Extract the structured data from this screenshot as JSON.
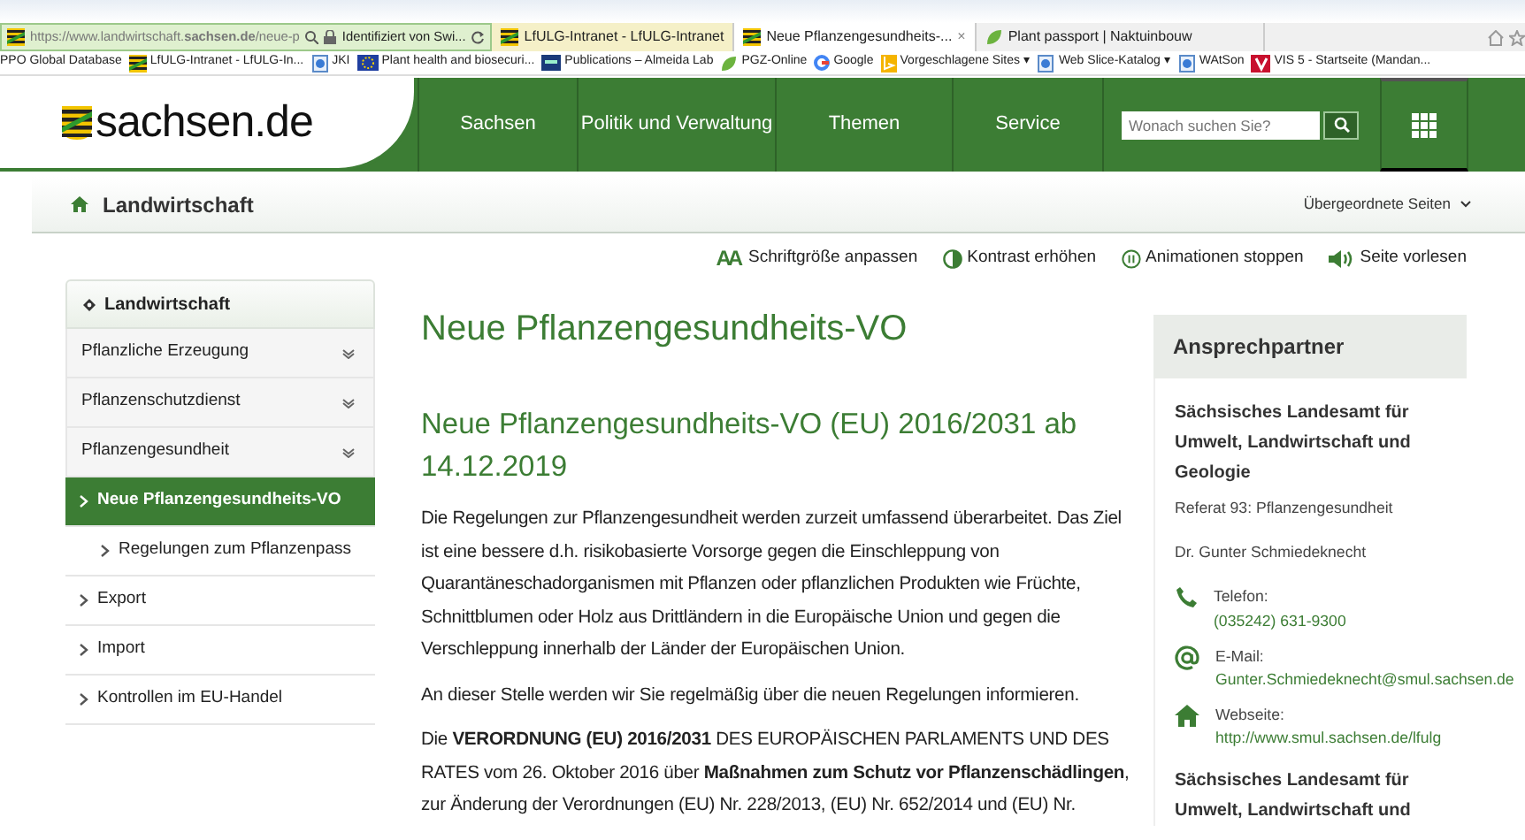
{
  "browser": {
    "address": {
      "url": "https://www.landwirtschaft.**sachsen.de**/neue-p",
      "security": "Identifiziert von Swi..."
    },
    "tabs": [
      {
        "label": "LfULG-Intranet - LfULG-Intranet",
        "selected": false,
        "kind": "crest"
      },
      {
        "label": "Neue Pflanzengesundheits-...",
        "selected": true,
        "kind": "crest",
        "close": "×"
      },
      {
        "label": "Plant passport | Naktuinbouw",
        "selected": false,
        "kind": "leaf"
      }
    ],
    "favorites": [
      {
        "label": "PPO Global Database"
      },
      {
        "label": "LfULG-Intranet - LfULG-In...",
        "kind": "crest"
      },
      {
        "label": "JKI",
        "kind": "page"
      },
      {
        "label": "Plant health and biosecuri...",
        "kind": "flag"
      },
      {
        "label": "Publications – Almeida Lab",
        "kind": "square"
      },
      {
        "label": "PGZ-Online",
        "kind": "leaf"
      },
      {
        "label": "Google",
        "kind": "google"
      },
      {
        "label": "Vorgeschlagene Sites ▾",
        "kind": "bing"
      },
      {
        "label": "Web Slice-Katalog ▾",
        "kind": "page"
      },
      {
        "label": "WAtSon",
        "kind": "page"
      },
      {
        "label": "VIS 5 - Startseite (Mandan...",
        "kind": "vis"
      }
    ]
  },
  "site": {
    "logo": "sachsen.de",
    "nav": [
      "Sachsen",
      "Politik und Verwaltung",
      "Themen",
      "Service"
    ],
    "search": {
      "placeholder": "Wonach suchen Sie?"
    }
  },
  "breadcrumb": {
    "label": "Landwirtschaft",
    "parent_pages": "Übergeordnete Seiten"
  },
  "tools": [
    {
      "kind": "font",
      "icon": "AA",
      "label": "Schriftgröße anpassen"
    },
    {
      "kind": "contrast",
      "label": "Kontrast erhöhen"
    },
    {
      "kind": "pause",
      "label": "Animationen stoppen"
    },
    {
      "kind": "speaker",
      "label": "Seite vorlesen"
    }
  ],
  "sidebar": {
    "title": "Landwirtschaft",
    "items": [
      {
        "label": "Pflanzliche Erzeugung",
        "expandable": true,
        "selected": false
      },
      {
        "label": "Pflanzenschutzdienst",
        "expandable": true,
        "selected": false
      },
      {
        "label": "Pflanzengesundheit",
        "expandable": true,
        "selected": false
      },
      {
        "label": "Neue Pflanzengesundheits-VO",
        "expandable": false,
        "selected": true,
        "children": [
          {
            "label": "Regelungen zum Pflanzenpass",
            "expandable": false,
            "selected": false
          }
        ]
      },
      {
        "label": "Export",
        "expandable": false,
        "selected": false
      },
      {
        "label": "Import",
        "expandable": false,
        "selected": false
      },
      {
        "label": "Kontrollen im EU-Handel",
        "expandable": false,
        "selected": false
      }
    ]
  },
  "main": {
    "title": "Neue Pflanzengesundheits-VO",
    "subtitle": "Neue Pflanzengesundheits-VO (EU) 2016/2031 ab 14.12.2019",
    "paragraphs": [
      "Die Regelungen zur Pflanzengesundheit werden zurzeit umfassend überarbeitet. Das Ziel ist eine bessere d.h. risikobasierte Vorsorge gegen die Einschleppung von Quarantäneschadorganismen mit Pflanzen oder pflanzlichen Produkten wie Früchte, Schnittblumen oder Holz aus Drittländern in die Europäische Union und gegen die Verschleppung innerhalb der Länder der Europäischen Union.",
      "An dieser Stelle werden wir Sie regelmäßig über die neuen Regelungen informieren.",
      "Die **VERORDNUNG (EU) 2016/2031** DES EUROPÄISCHEN PARLAMENTS UND DES RATES vom 26. Oktober 2016 über **Maßnahmen zum Schutz vor Pflanzenschädlingen**, zur Änderung der Verordnungen (EU) Nr. 228/2013, (EU) Nr. 652/2014 und (EU) Nr."
    ]
  },
  "contact": {
    "title": "Ansprechpartner",
    "organization": "Sächsisches Landesamt für Umwelt, Landwirtschaft und Geologie",
    "department": "Referat 93: Pflanzengesundheit",
    "person": "Dr. Gunter Schmiedeknecht",
    "entries": [
      {
        "kind": "phone",
        "label": "Telefon:",
        "value": "(035242) 631-9300"
      },
      {
        "kind": "email",
        "label": "E-Mail:",
        "value": "Gunter.Schmiedeknecht@smul.sachsen.de"
      },
      {
        "kind": "web",
        "label": "Webseite:",
        "value": "http://www.smul.sachsen.de/lfulg"
      }
    ],
    "organization_2": "Sächsisches Landesamt für Umwelt, Landwirtschaft und"
  }
}
